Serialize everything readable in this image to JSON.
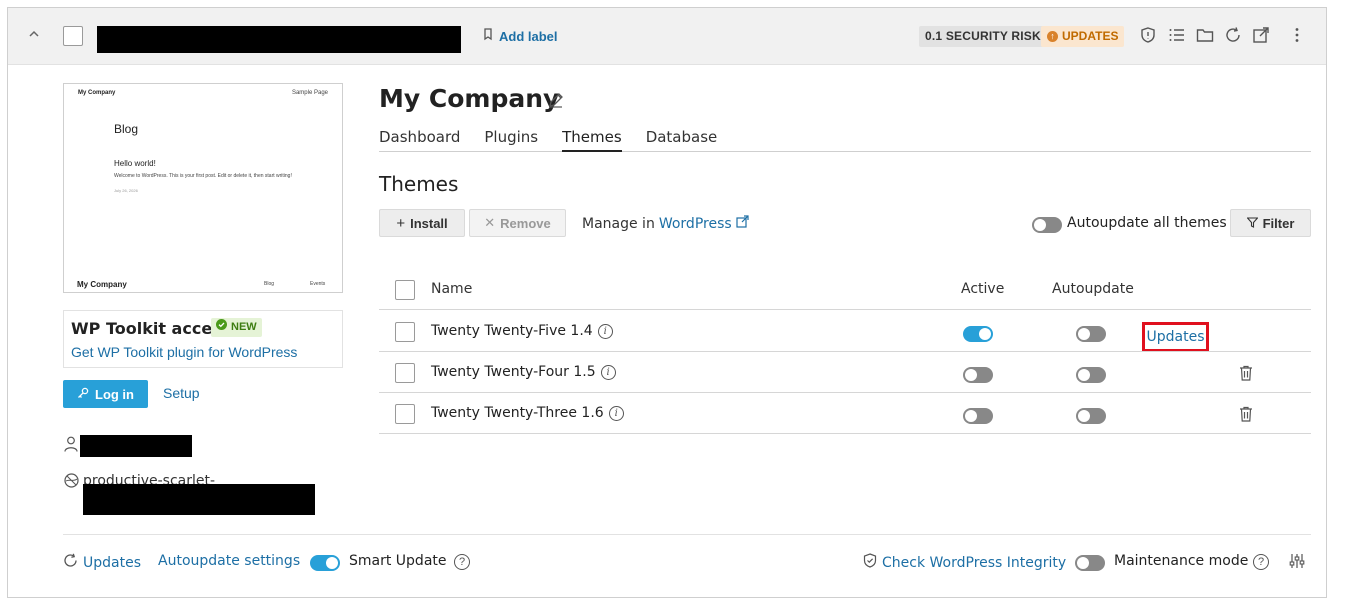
{
  "header": {
    "add_label": "Add label",
    "security_risk": "0.1 SECURITY RISK",
    "updates_badge": "UPDATES"
  },
  "preview": {
    "site_title": "My Company",
    "nav_sample": "Sample Page",
    "heading": "Blog",
    "post_title": "Hello world!",
    "post_excerpt": "Welcome to WordPress. This is your first post. Edit or delete it, then start writing!",
    "post_date": "July 26, 2026",
    "footer_title": "My Company",
    "footer_blog": "Blog",
    "footer_events": "Events"
  },
  "toolkit": {
    "title": "WP Toolkit access",
    "new_badge": "NEW",
    "link": "Get WP Toolkit plugin for WordPress"
  },
  "actions": {
    "login": "Log in",
    "setup": "Setup"
  },
  "site": {
    "domain_prefix": "productive-scarlet-"
  },
  "main": {
    "site_name": "My Company",
    "tabs": [
      "Dashboard",
      "Plugins",
      "Themes",
      "Database"
    ],
    "active_tab": "Themes",
    "section_title": "Themes",
    "install": "Install",
    "remove": "Remove",
    "manage_in": "Manage in",
    "wordpress_link": "WordPress",
    "autoupdate_all": "Autoupdate all themes",
    "filter": "Filter"
  },
  "table": {
    "headers": {
      "name": "Name",
      "active": "Active",
      "autoupdate": "Autoupdate"
    },
    "rows": [
      {
        "name": "Twenty Twenty-Five 1.4",
        "active": true,
        "autoupdate": false,
        "action": "Updates"
      },
      {
        "name": "Twenty Twenty-Four 1.5",
        "active": false,
        "autoupdate": false,
        "action": "delete"
      },
      {
        "name": "Twenty Twenty-Three 1.6",
        "active": false,
        "autoupdate": false,
        "action": "delete"
      }
    ]
  },
  "footer": {
    "updates": "Updates",
    "autoupdate_settings": "Autoupdate settings",
    "smart_update": "Smart Update",
    "check_integrity": "Check WordPress Integrity",
    "maintenance_mode": "Maintenance mode",
    "smart_update_on": true,
    "maintenance_on": false
  },
  "colors": {
    "accent": "#28a0d8",
    "link": "#1d6fa5",
    "highlight_box": "#e0101e",
    "warning": "#c06a00",
    "success": "#3e7d12"
  }
}
